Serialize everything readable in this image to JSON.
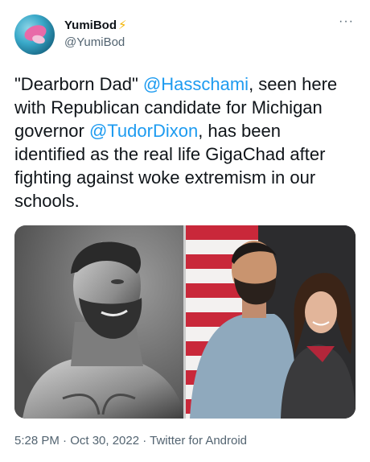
{
  "tweet": {
    "display_name": "YumiBod",
    "verified_emoji": "⚡",
    "handle": "@YumiBod",
    "more_label": "···",
    "text_parts": [
      {
        "text": "\"Dearborn Dad\" ",
        "type": "text"
      },
      {
        "text": "@Hasschami",
        "type": "mention"
      },
      {
        "text": ", seen here with Republican candidate for Michigan governor ",
        "type": "text"
      },
      {
        "text": "@TudorDixon",
        "type": "mention"
      },
      {
        "text": ", has been identified as the real life GigaChad after fighting against woke extremism in our schools.",
        "type": "text"
      }
    ],
    "footer": "5:28 PM · Oct 30, 2022 · Twitter for Android"
  },
  "colors": {
    "mention": "#1d9bf0",
    "secondary_text": "#536471",
    "bolt": "#f4b400"
  },
  "icons": {
    "more": "more-options-icon",
    "bolt": "lightning-bolt-emoji"
  }
}
